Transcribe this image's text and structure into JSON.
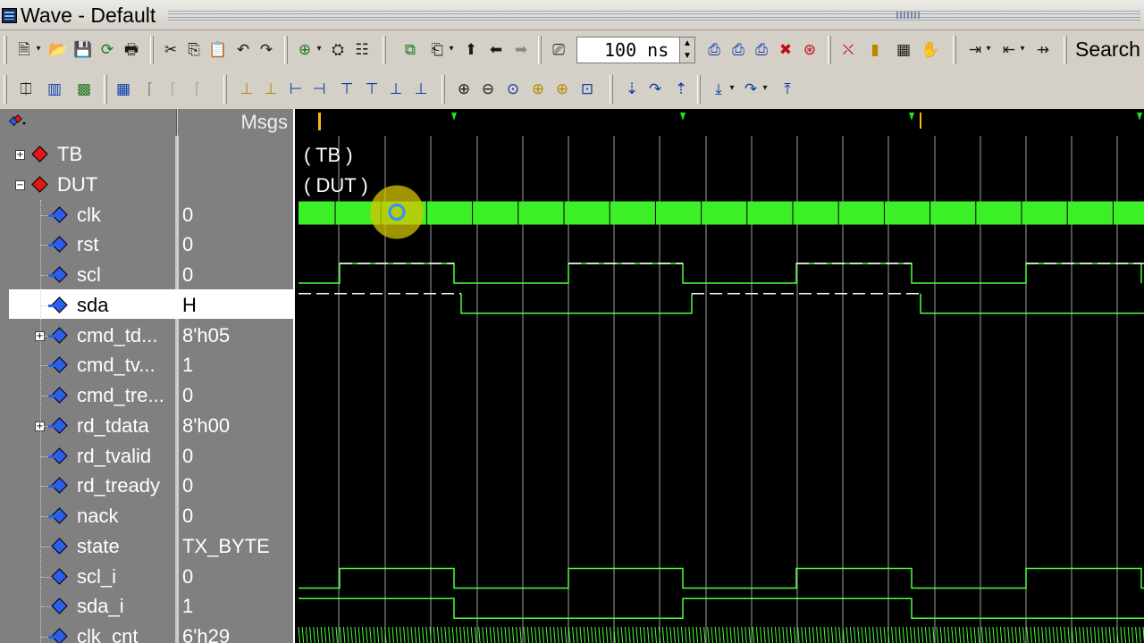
{
  "window": {
    "title": "Wave - Default"
  },
  "toolbar": {
    "time_value": "100 ns",
    "search_label": "Search"
  },
  "header": {
    "msgs_label": "Msgs"
  },
  "signals": [
    {
      "name": "TB",
      "value": "",
      "kind": "group",
      "expander": "+",
      "label": "( TB )"
    },
    {
      "name": "DUT",
      "value": "",
      "kind": "group",
      "expander": "-",
      "label": "( DUT )"
    },
    {
      "name": "clk",
      "value": "0",
      "kind": "in"
    },
    {
      "name": "rst",
      "value": "0",
      "kind": "in"
    },
    {
      "name": "scl",
      "value": "0",
      "kind": "in"
    },
    {
      "name": "sda",
      "value": "H",
      "kind": "inout",
      "selected": true
    },
    {
      "name": "cmd_td...",
      "value": "8'h05",
      "kind": "in",
      "expander": "+"
    },
    {
      "name": "cmd_tv...",
      "value": "1",
      "kind": "in"
    },
    {
      "name": "cmd_tre...",
      "value": "0",
      "kind": "in"
    },
    {
      "name": "rd_tdata",
      "value": "8'h00",
      "kind": "in",
      "expander": "+"
    },
    {
      "name": "rd_tvalid",
      "value": "0",
      "kind": "in"
    },
    {
      "name": "rd_tready",
      "value": "0",
      "kind": "in"
    },
    {
      "name": "nack",
      "value": "0",
      "kind": "in"
    },
    {
      "name": "state",
      "value": "TX_BYTE",
      "kind": "internal"
    },
    {
      "name": "scl_i",
      "value": "0",
      "kind": "internal"
    },
    {
      "name": "sda_i",
      "value": "1",
      "kind": "internal"
    },
    {
      "name": "clk_cnt",
      "value": "6'h29",
      "kind": "in"
    }
  ],
  "colors": {
    "wave": "#4cff3a",
    "clk_fill": "#3cf028",
    "grid": "#a0a0a0",
    "cursor": "#ffb020",
    "marker": "#20e020"
  }
}
